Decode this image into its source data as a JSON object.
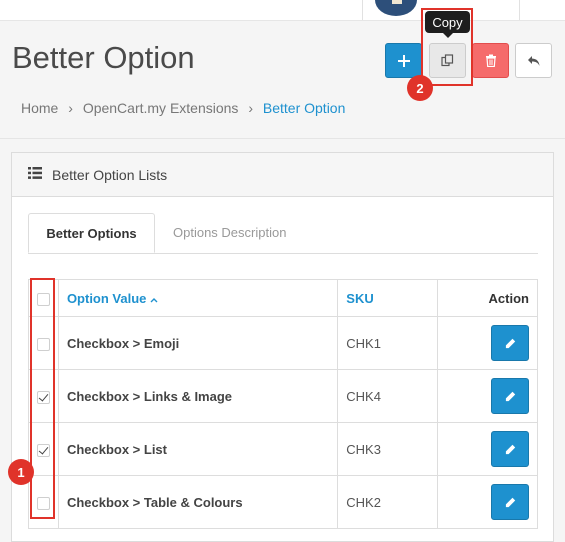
{
  "page": {
    "title": "Better Option"
  },
  "toolbar": {
    "add_icon": "plus-icon",
    "copy_icon": "copy-icon",
    "delete_icon": "trash-icon",
    "back_icon": "reply-icon",
    "tooltip": "Copy"
  },
  "breadcrumb": {
    "items": [
      "Home",
      "OpenCart.my Extensions",
      "Better Option"
    ],
    "separator": "›"
  },
  "panel": {
    "title": "Better Option Lists",
    "icon": "list-icon"
  },
  "tabs": [
    {
      "label": "Better Options",
      "active": true
    },
    {
      "label": "Options Description",
      "active": false
    }
  ],
  "table": {
    "headers": {
      "option_value": "Option Value",
      "sku": "SKU",
      "action": "Action"
    },
    "rows": [
      {
        "option": "Checkbox > Emoji",
        "sku": "CHK1",
        "checked": false
      },
      {
        "option": "Checkbox > Links & Image",
        "sku": "CHK4",
        "checked": true
      },
      {
        "option": "Checkbox > List",
        "sku": "CHK3",
        "checked": true
      },
      {
        "option": "Checkbox > Table & Colours",
        "sku": "CHK2",
        "checked": false
      }
    ]
  },
  "annotations": {
    "marker_1": "1",
    "marker_2": "2"
  },
  "colors": {
    "primary": "#1e91cf",
    "danger": "#f56b6b",
    "annotation": "#e0332a"
  }
}
